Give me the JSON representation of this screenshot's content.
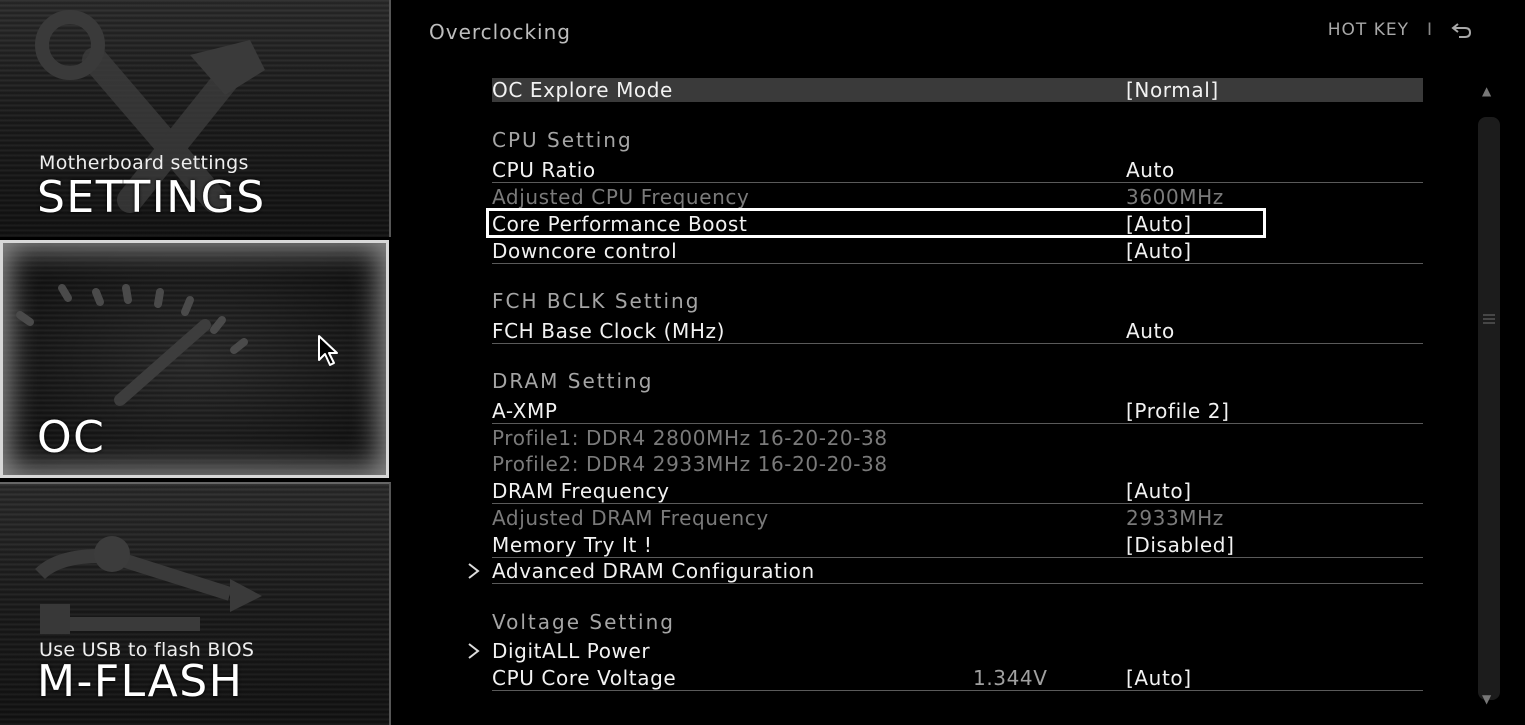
{
  "sidebar": {
    "settings": {
      "subtitle": "Motherboard settings",
      "title": "SETTINGS"
    },
    "oc": {
      "title": "OC"
    },
    "mflash": {
      "subtitle": "Use USB to flash BIOS",
      "title": "M-FLASH"
    }
  },
  "header": {
    "title": "Overclocking",
    "hotkey_label": "HOT KEY",
    "separator": "I"
  },
  "rows": {
    "oc_explore_mode": {
      "label": "OC Explore Mode",
      "value": "[Normal]"
    },
    "cpu_setting": {
      "label": "CPU  Setting"
    },
    "cpu_ratio": {
      "label": "CPU Ratio",
      "value": "Auto"
    },
    "adjusted_cpu_freq": {
      "label": "Adjusted CPU Frequency",
      "value": "3600MHz"
    },
    "core_perf_boost": {
      "label": "Core Performance Boost",
      "value": "[Auto]"
    },
    "downcore_control": {
      "label": "Downcore control",
      "value": "[Auto]"
    },
    "fch_bclk_setting": {
      "label": "FCH  BCLK  Setting"
    },
    "fch_base_clock": {
      "label": "FCH Base Clock (MHz)",
      "value": "Auto"
    },
    "dram_setting": {
      "label": "DRAM  Setting"
    },
    "a_xmp": {
      "label": "A-XMP",
      "value": "[Profile 2]"
    },
    "profile1": {
      "label": "Profile1: DDR4 2800MHz 16-20-20-38"
    },
    "profile2": {
      "label": "Profile2: DDR4 2933MHz 16-20-20-38"
    },
    "dram_frequency": {
      "label": "DRAM Frequency",
      "value": "[Auto]"
    },
    "adjusted_dram_freq": {
      "label": "Adjusted DRAM Frequency",
      "value": "2933MHz"
    },
    "memory_try_it": {
      "label": "Memory Try It !",
      "value": "[Disabled]"
    },
    "advanced_dram": {
      "label": "Advanced DRAM Configuration"
    },
    "voltage_setting": {
      "label": "Voltage  Setting"
    },
    "digitall_power": {
      "label": "DigitALL Power"
    },
    "cpu_core_voltage": {
      "label": "CPU Core Voltage",
      "current": "1.344V",
      "value": "[Auto]"
    }
  }
}
